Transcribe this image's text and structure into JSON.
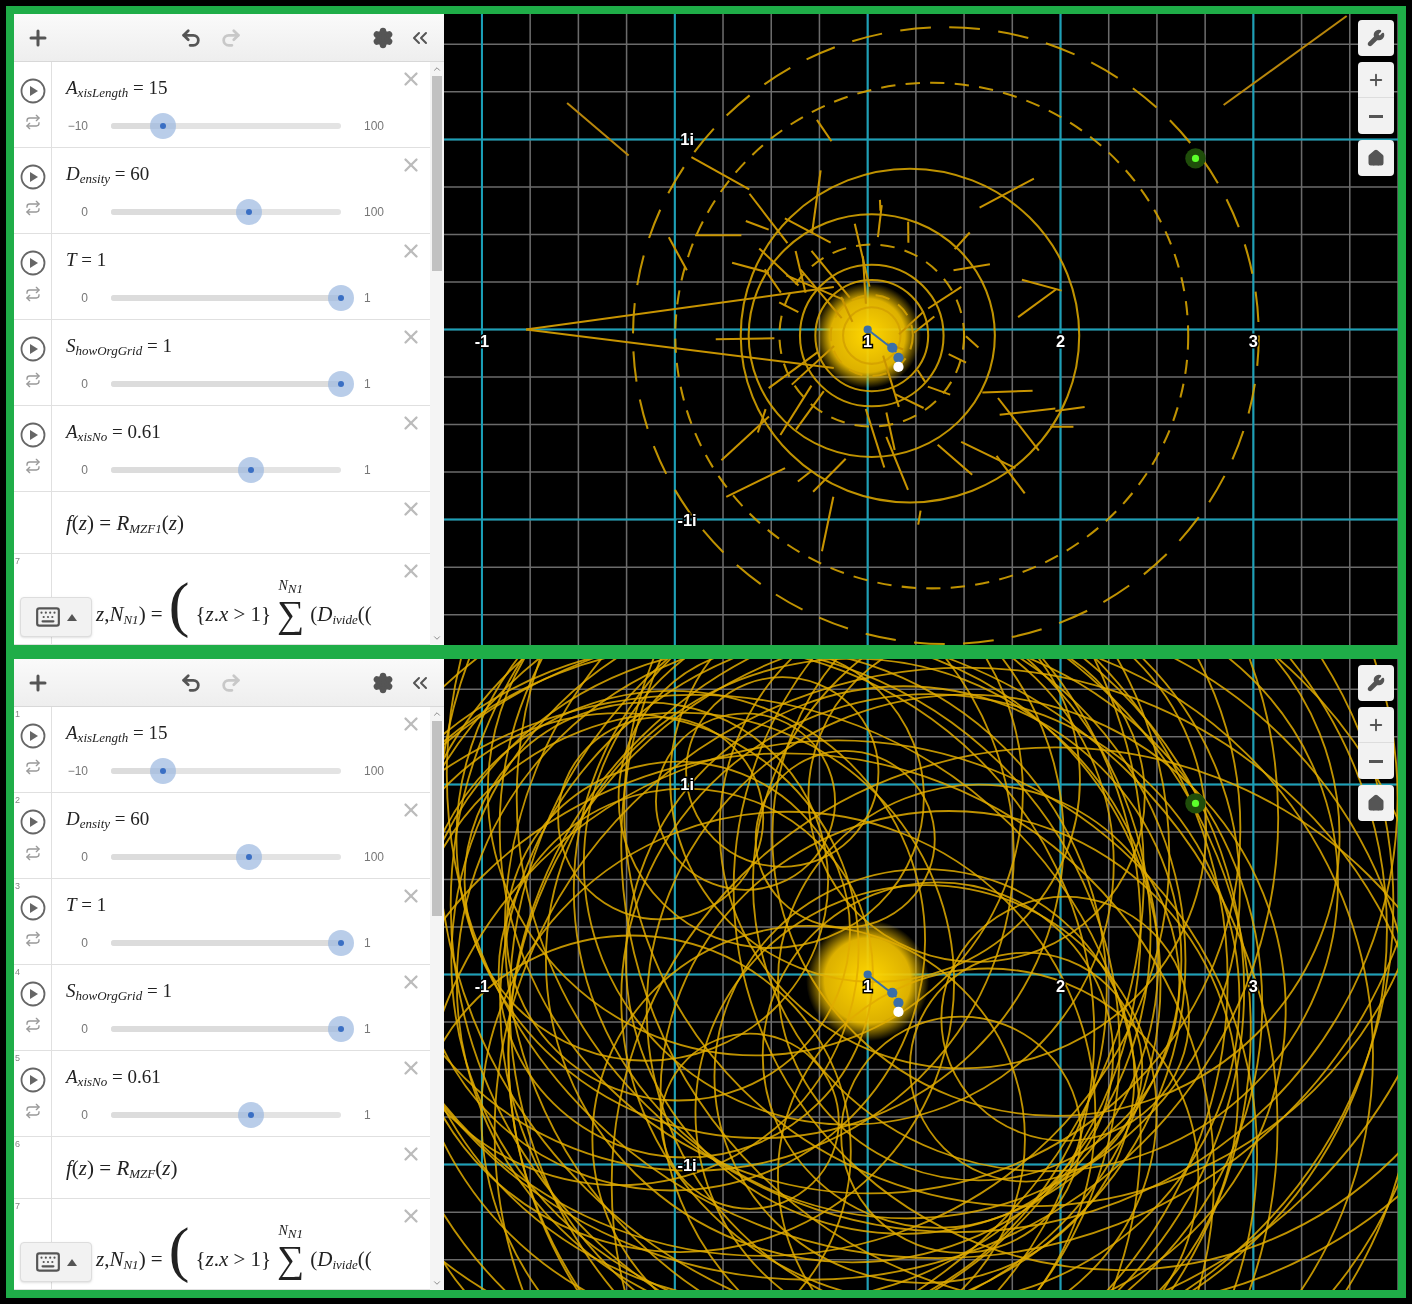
{
  "panes": [
    {
      "toolbar": {
        "redo_disabled": true
      },
      "rows": [
        {
          "kind": "slider",
          "formula": "*A*$_{xisLength}$ = 15",
          "min": "−10",
          "max": "100",
          "level": 0.227
        },
        {
          "kind": "slider",
          "formula": "*D*$_{ensity}$ = 60",
          "min": "0",
          "max": "100",
          "level": 0.6
        },
        {
          "kind": "slider",
          "formula": "*T* = 1",
          "min": "0",
          "max": "1",
          "level": 1
        },
        {
          "kind": "slider",
          "formula": "*S*$_{howOrgGrid}$ = 1",
          "min": "0",
          "max": "1",
          "level": 1
        },
        {
          "kind": "slider",
          "formula": "*A*$_{xisNo}$ = 0.61",
          "min": "0",
          "max": "1",
          "level": 0.61
        },
        {
          "kind": "formula",
          "formula": "*f*(*z*) = *R*$_{MZF1}$(*z*)"
        },
        {
          "kind": "sum",
          "number": "7",
          "before": "*z*,*N*$_{N1}$) =",
          "paren": "(",
          "condition": "{*z*.*x* > 1}",
          "sigma": "∑",
          "upper": "*N*$_{N1}$",
          "after": "(*D*$_{ivide}$(("
        }
      ],
      "graph": {
        "kind": "sparse",
        "x_labels": [
          "-1",
          "1",
          "2",
          "3"
        ],
        "y_labels": [
          "1i",
          "-1i"
        ]
      }
    },
    {
      "toolbar": {
        "redo_disabled": true
      },
      "rows": [
        {
          "kind": "slider",
          "number": "1",
          "formula": "*A*$_{xisLength}$ = 15",
          "min": "−10",
          "max": "100",
          "level": 0.227
        },
        {
          "kind": "slider",
          "number": "2",
          "formula": "*D*$_{ensity}$ = 60",
          "min": "0",
          "max": "100",
          "level": 0.6
        },
        {
          "kind": "slider",
          "number": "3",
          "formula": "*T* = 1",
          "min": "0",
          "max": "1",
          "level": 1
        },
        {
          "kind": "slider",
          "number": "4",
          "formula": "*S*$_{howOrgGrid}$ = 1",
          "min": "0",
          "max": "1",
          "level": 1
        },
        {
          "kind": "slider",
          "number": "5",
          "formula": "*A*$_{xisNo}$ = 0.61",
          "min": "0",
          "max": "1",
          "level": 0.61
        },
        {
          "kind": "formula",
          "number": "6",
          "formula": "*f*(*z*) = *R*$_{MZF}$(*z*)"
        },
        {
          "kind": "sum",
          "number": "7",
          "before": "*z*,*N*$_{N1}$) =",
          "paren": "(",
          "condition": "{*z*.*x* > 1}",
          "sigma": "∑",
          "upper": "*N*$_{N1}$",
          "after": "(*D*$_{ivide}$(("
        }
      ],
      "graph": {
        "kind": "dense",
        "x_labels": [
          "-1",
          "1",
          "2",
          "3"
        ],
        "y_labels": [
          "1i",
          "-1i"
        ]
      }
    }
  ]
}
